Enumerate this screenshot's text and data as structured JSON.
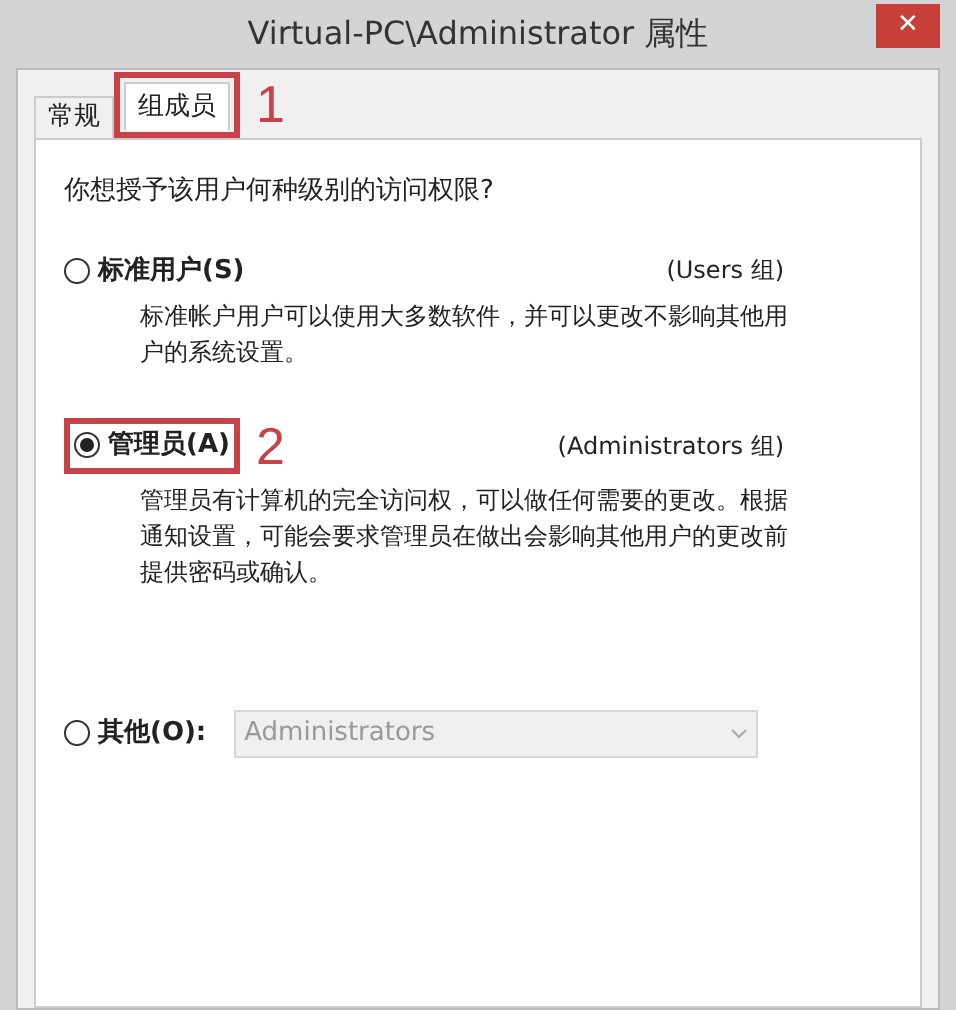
{
  "window": {
    "title": "Virtual-PC\\Administrator 属性",
    "close": "✕"
  },
  "tabs": [
    {
      "label": "常规",
      "selected": false
    },
    {
      "label": "组成员",
      "selected": true,
      "annotation": "1"
    }
  ],
  "question": "你想授予该用户何种级别的访问权限?",
  "options": [
    {
      "kind": "radio",
      "label": "标准用户(S)",
      "group": "(Users 组)",
      "description": "标准帐户用户可以使用大多数软件，并可以更改不影响其他用户的系统设置。",
      "selected": false
    },
    {
      "kind": "radio",
      "label": "管理员(A)",
      "group": "(Administrators 组)",
      "description": "管理员有计算机的完全访问权，可以做任何需要的更改。根据通知设置，可能会要求管理员在做出会影响其他用户的更改前提供密码或确认。",
      "selected": true,
      "annotation": "2"
    },
    {
      "kind": "select",
      "label": "其他(O):",
      "value": "Administrators",
      "disabled": true,
      "selected": false
    }
  ]
}
